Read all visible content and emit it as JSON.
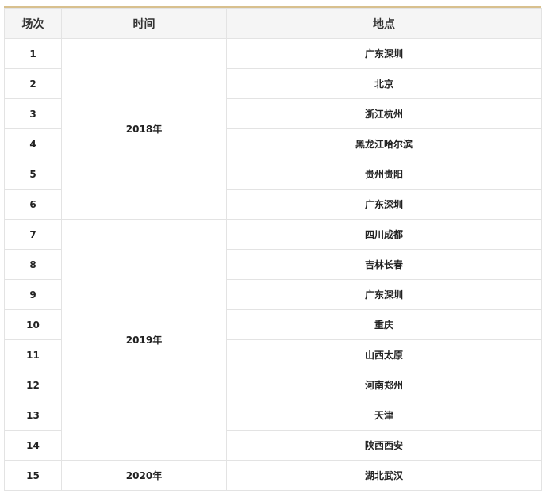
{
  "table": {
    "headers": [
      "场次",
      "时间",
      "地点"
    ],
    "rows": [
      {
        "no": "1",
        "loc": "广东深圳"
      },
      {
        "no": "2",
        "loc": "北京"
      },
      {
        "no": "3",
        "loc": "浙江杭州"
      },
      {
        "no": "4",
        "loc": "黑龙江哈尔滨"
      },
      {
        "no": "5",
        "loc": "贵州贵阳"
      },
      {
        "no": "6",
        "loc": "广东深圳"
      },
      {
        "no": "7",
        "loc": "四川成都"
      },
      {
        "no": "8",
        "loc": "吉林长春"
      },
      {
        "no": "9",
        "loc": "广东深圳"
      },
      {
        "no": "10",
        "loc": "重庆"
      },
      {
        "no": "11",
        "loc": "山西太原"
      },
      {
        "no": "12",
        "loc": "河南郑州"
      },
      {
        "no": "13",
        "loc": "天津"
      },
      {
        "no": "14",
        "loc": "陕西西安"
      },
      {
        "no": "15",
        "loc": "湖北武汉"
      }
    ],
    "years": [
      {
        "label": "2018年",
        "rows": 6
      },
      {
        "label": "2019年",
        "rows": 8
      },
      {
        "label": "2020年",
        "rows": 1
      }
    ]
  },
  "colors": {
    "top_border": "#d8c08e",
    "header_bg": "#f5f5f5",
    "grid_line": "#e3e3e3"
  }
}
